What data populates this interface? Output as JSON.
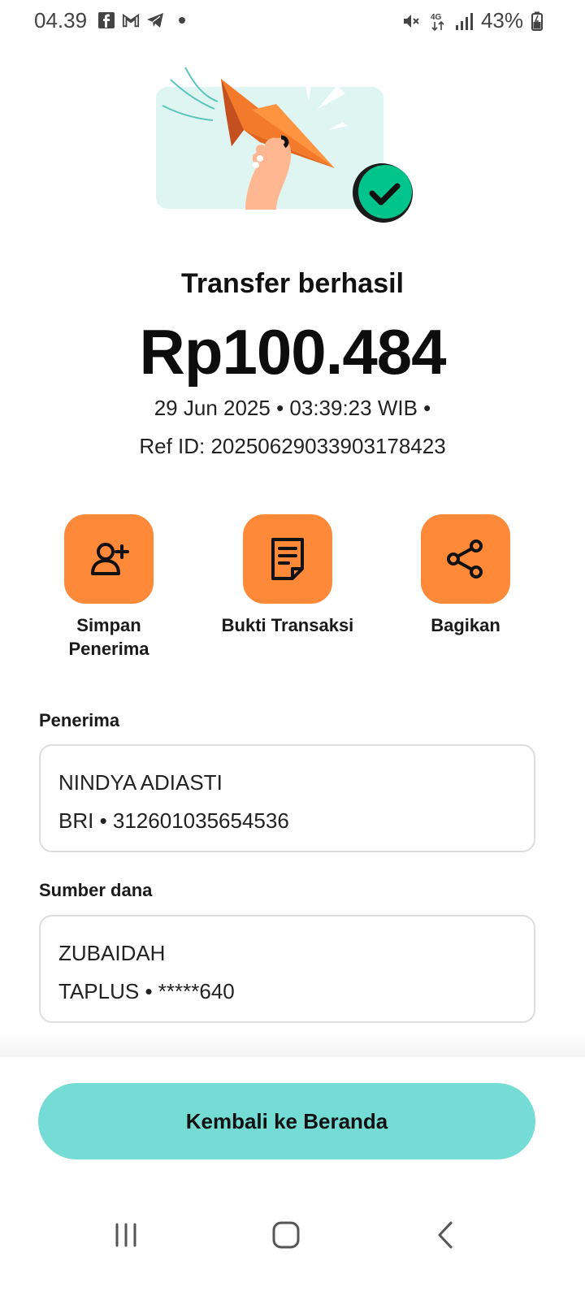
{
  "status_bar": {
    "time": "04.39",
    "notification_icons": [
      "facebook-icon",
      "gmail-icon",
      "telegram-icon"
    ],
    "network": "4G",
    "battery": "43%"
  },
  "result": {
    "title": "Transfer berhasil",
    "amount": "Rp100.484",
    "datetime": "29 Jun 2025 • 03:39:23 WIB •",
    "ref": "Ref ID: 20250629033903178423"
  },
  "actions": [
    {
      "label_line1": "Simpan",
      "label_line2": "Penerima",
      "icon": "add-user-icon"
    },
    {
      "label_line1": "Bukti Transaksi",
      "label_line2": "",
      "icon": "receipt-icon"
    },
    {
      "label_line1": "Bagikan",
      "label_line2": "",
      "icon": "share-icon"
    }
  ],
  "recipient": {
    "label": "Penerima",
    "name": "NINDYA ADIASTI",
    "account": "BRI • 312601035654536"
  },
  "source": {
    "label": "Sumber dana",
    "name": "ZUBAIDAH",
    "account": "TAPLUS • *****640"
  },
  "footer": {
    "button_label": "Kembali ke Beranda"
  },
  "colors": {
    "accent_orange": "#fd8939",
    "button_teal": "#74dcd5",
    "success_green": "#00c48c"
  }
}
